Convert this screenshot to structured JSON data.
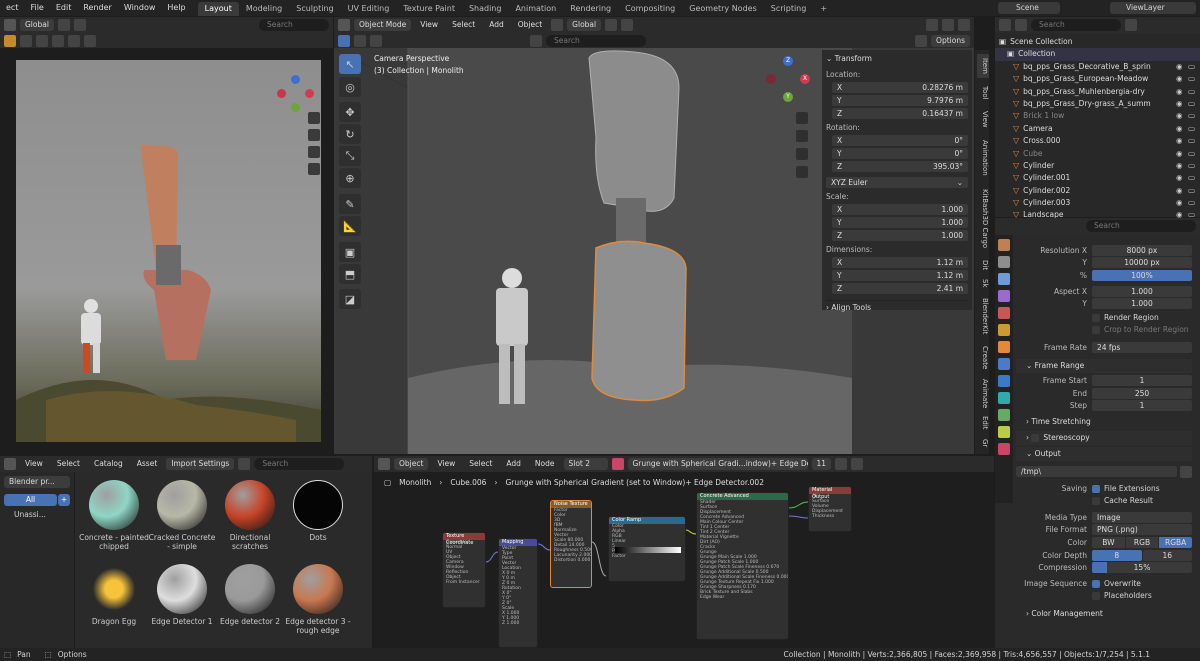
{
  "topmenu": {
    "app_menu_cut": "ect",
    "file": "File",
    "edit": "Edit",
    "render": "Render",
    "window": "Window",
    "help": "Help",
    "workspaces": [
      "Layout",
      "Modeling",
      "Sculpting",
      "UV Editing",
      "Texture Paint",
      "Shading",
      "Animation",
      "Rendering",
      "Compositing",
      "Geometry Nodes",
      "Scripting"
    ],
    "add_tab": "+",
    "scene": "Scene",
    "view_layer": "ViewLayer"
  },
  "left_viewport": {
    "transform": "Global",
    "search_placeholder": "Search"
  },
  "viewport": {
    "mode": "Object Mode",
    "menus": [
      "View",
      "Select",
      "Add",
      "Object"
    ],
    "transform": "Global",
    "options": "Options",
    "title": "Camera Perspective",
    "subtitle": "(3) Collection | Monolith",
    "gizmo": {
      "x": "X",
      "y": "Y",
      "z": "Z"
    }
  },
  "transform_panel": {
    "header": "Transform",
    "location_label": "Location:",
    "location": [
      {
        "axis": "X",
        "value": "0.28276 m"
      },
      {
        "axis": "Y",
        "value": "9.7976 m"
      },
      {
        "axis": "Z",
        "value": "0.16437 m"
      }
    ],
    "rotation_label": "Rotation:",
    "rotation": [
      {
        "axis": "X",
        "value": "0°"
      },
      {
        "axis": "Y",
        "value": "0°"
      },
      {
        "axis": "Z",
        "value": "395.03°"
      }
    ],
    "rotation_mode": "XYZ Euler",
    "scale_label": "Scale:",
    "scale": [
      {
        "axis": "X",
        "value": "1.000"
      },
      {
        "axis": "Y",
        "value": "1.000"
      },
      {
        "axis": "Z",
        "value": "1.000"
      }
    ],
    "dimensions_label": "Dimensions:",
    "dimensions": [
      {
        "axis": "X",
        "value": "1.12 m"
      },
      {
        "axis": "Y",
        "value": "1.12 m"
      },
      {
        "axis": "Z",
        "value": "2.41 m"
      }
    ],
    "align_tools": "Align Tools"
  },
  "sidebar_tabs": [
    "Item",
    "Tool",
    "View",
    "Animation",
    "KitBash3D Cargo",
    "Dit",
    "Sk",
    "BlenderKit",
    "Create",
    "Animate",
    "Edit",
    "Gr"
  ],
  "outliner": {
    "search_placeholder": "Search",
    "scene_collection": "Scene Collection",
    "collection": "Collection",
    "items": [
      {
        "name": "bq_pps_Grass_Decorative_B_sprin",
        "dim": false
      },
      {
        "name": "bq_pps_Grass_European-Meadow",
        "dim": false
      },
      {
        "name": "bq_pps_Grass_Muhlenbergia-dry",
        "dim": false
      },
      {
        "name": "bq_pps_Grass_Dry-grass_A_summ",
        "dim": false
      },
      {
        "name": "Brick 1 low",
        "dim": true
      },
      {
        "name": "Camera",
        "dim": false
      },
      {
        "name": "Cross.000",
        "dim": false
      },
      {
        "name": "Cube",
        "dim": true
      },
      {
        "name": "Cylinder",
        "dim": false
      },
      {
        "name": "Cylinder.001",
        "dim": false
      },
      {
        "name": "Cylinder.002",
        "dim": false
      },
      {
        "name": "Cylinder.003",
        "dim": false
      },
      {
        "name": "Landscape",
        "dim": false
      }
    ]
  },
  "properties": {
    "search_placeholder": "Search",
    "resolution_x_label": "Resolution X",
    "resolution_x": "8000 px",
    "resolution_y_label": "Y",
    "resolution_y": "10000 px",
    "percent_label": "%",
    "percent": "100%",
    "aspect_x_label": "Aspect X",
    "aspect_x": "1.000",
    "aspect_y_label": "Y",
    "aspect_y": "1.000",
    "render_region": "Render Region",
    "crop_region": "Crop to Render Region",
    "frame_rate_label": "Frame Rate",
    "frame_rate": "24 fps",
    "frame_range": "Frame Range",
    "frame_start_label": "Frame Start",
    "frame_start": "1",
    "end_label": "End",
    "end": "250",
    "step_label": "Step",
    "step": "1",
    "time_stretching": "Time Stretching",
    "stereoscopy": "Stereoscopy",
    "output": "Output",
    "path": "/tmp\\",
    "saving_label": "Saving",
    "file_extensions": "File Extensions",
    "cache_result": "Cache Result",
    "media_type_label": "Media Type",
    "media_type": "Image",
    "file_format_label": "File Format",
    "file_format": "PNG (.png)",
    "color_label": "Color",
    "color_options": [
      "BW",
      "RGB",
      "RGBA"
    ],
    "color_selected": "RGBA",
    "color_depth_label": "Color Depth",
    "color_depth_options": [
      "8",
      "16"
    ],
    "color_depth_selected": "8",
    "compression_label": "Compression",
    "compression": "15%",
    "compression_fraction": 0.15,
    "image_sequence_label": "Image Sequence",
    "overwrite": "Overwrite",
    "placeholders": "Placeholders",
    "color_management": "Color Management"
  },
  "asset_browser": {
    "menus": [
      "View",
      "Select",
      "Catalog",
      "Asset"
    ],
    "import_settings": "Import Settings",
    "search_placeholder": "Search",
    "library": "Blender pr...",
    "all": "All",
    "unassigned": "Unassi...",
    "assets": [
      {
        "name": "Concrete - painted chipped",
        "color": "#8fd6c6"
      },
      {
        "name": "Cracked Concrete - simple",
        "color": "#b8b8a8"
      },
      {
        "name": "Directional scratches",
        "color": "#c84428"
      },
      {
        "name": "Dots",
        "color": "#050505"
      },
      {
        "name": "Dragon Egg",
        "color": "#f2b01a"
      },
      {
        "name": "Edge Detector 1",
        "color": "#dedede"
      },
      {
        "name": "Edge detector 2",
        "color": "#9a9a9a"
      },
      {
        "name": "Edge detector 3 - rough edge",
        "color": "#c87850"
      }
    ]
  },
  "node_editor": {
    "object": "Object",
    "menus": [
      "View",
      "Select",
      "Add",
      "Node"
    ],
    "slot": "Slot 2",
    "material": "Grunge with Spherical Gradi...indow)+ Edge Detector.002",
    "users": "11",
    "breadcrumb": [
      "Monolith",
      "Cube.006",
      "Grunge with Spherical Gradient (set to Window)+ Edge Detector.002"
    ],
    "nodes": {
      "texcoord": {
        "title": "Texture Coordinate",
        "lines": [
          "Generated",
          "Normal",
          "UV",
          "Object",
          "Camera",
          "Window",
          "Reflection",
          "Object",
          "From Instancer"
        ]
      },
      "mapping": {
        "title": "Mapping",
        "lines": [
          "Vector",
          "Type",
          "Point",
          "Vector",
          "Location",
          "X 0 m",
          "Y 0 m",
          "Z 0 m",
          "Rotation",
          "X 0°",
          "Y 0°",
          "Z 0°",
          "Scale",
          "X 1.000",
          "Y 1.000",
          "Z 1.000"
        ]
      },
      "noise": {
        "title": "Noise Texture",
        "lines": [
          "Factor",
          "Color",
          "3D",
          "fBM",
          "Normalize",
          "Vector",
          "Scale 80.000",
          "Detail 14.000",
          "Roughness 0.500",
          "Lacunarity 2.000",
          "Distortion 0.000"
        ]
      },
      "ramp": {
        "title": "Color Ramp",
        "lines": [
          "Color",
          "Alpha",
          "RGB",
          "Linear",
          "5",
          "Pos 0.536",
          "Factor"
        ]
      },
      "concrete": {
        "title": "Concrete Advanced",
        "lines": [
          "Shader",
          "Surface",
          "Displacement",
          "Concrete Advanced",
          "Main Colour Center",
          "Tint 1 Center",
          "Tint 2 Center",
          "Material Vignette",
          "Dirt (AO)",
          "Cracks",
          "Grunge",
          "Grunge Main Scale 1.000",
          "Grunge Patch Scale 1.000",
          "Grunge Patch Scale Fineness 0.670",
          "Grunge Additional Scale 0.500",
          "Grunge Additional Scale Fineness 0.000",
          "Grunge Texture Repeat Fix 1.000",
          "Grunge Sharpness 0.170",
          "Brick Texture and Slabs",
          "Edge Wear"
        ]
      },
      "output": {
        "title": "Material Output",
        "lines": [
          "All",
          "Surface",
          "Volume",
          "Displacement",
          "Thickness"
        ]
      }
    }
  },
  "statusbar": {
    "pan": "Pan",
    "options": "Options",
    "info": "Collection | Monolith | Verts:2,366,805 | Faces:2,369,958 | Tris:4,656,557 | Objects:1/7,254 | 5.1.1"
  },
  "colors": {
    "accent": "#4772b3",
    "selection": "#e08a3a"
  }
}
